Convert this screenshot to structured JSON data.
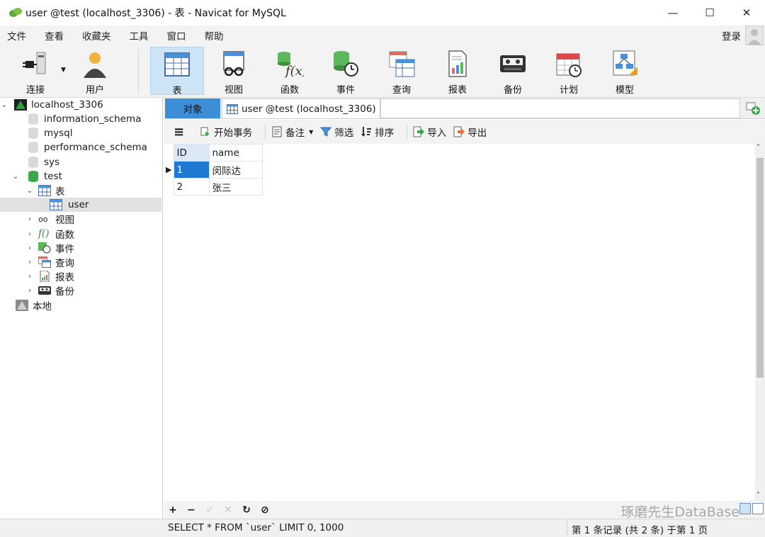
{
  "window": {
    "title": "user @test (localhost_3306) - 表 - Navicat for MySQL",
    "minimize": "—",
    "maximize": "☐",
    "close": "✕"
  },
  "menu": {
    "items": [
      "文件",
      "查看",
      "收藏夹",
      "工具",
      "窗口",
      "帮助"
    ],
    "login": "登录"
  },
  "toolbar": {
    "buttons": [
      {
        "label": "连接",
        "icon": "connection-icon"
      },
      {
        "label": "用户",
        "icon": "user-icon"
      },
      {
        "label": "表",
        "icon": "table-icon",
        "active": true
      },
      {
        "label": "视图",
        "icon": "view-icon"
      },
      {
        "label": "函数",
        "icon": "function-icon"
      },
      {
        "label": "事件",
        "icon": "event-icon"
      },
      {
        "label": "查询",
        "icon": "query-icon"
      },
      {
        "label": "报表",
        "icon": "report-icon"
      },
      {
        "label": "备份",
        "icon": "backup-icon"
      },
      {
        "label": "计划",
        "icon": "schedule-icon"
      },
      {
        "label": "模型",
        "icon": "model-icon"
      }
    ]
  },
  "tree": {
    "connection": "localhost_3306",
    "databases": [
      "information_schema",
      "mysql",
      "performance_schema",
      "sys"
    ],
    "open_db": "test",
    "tables_group": "表",
    "table": "user",
    "groups": [
      "视图",
      "函数",
      "事件",
      "查询",
      "报表",
      "备份"
    ],
    "local": "本地"
  },
  "tabs": {
    "objects": "对象",
    "user_tab": "user @test (localhost_3306) ..."
  },
  "subtoolbar": {
    "begin_tx": "开始事务",
    "comment": "备注",
    "filter": "筛选",
    "sort": "排序",
    "import": "导入",
    "export": "导出"
  },
  "grid": {
    "columns": [
      "ID",
      "name"
    ],
    "rows": [
      [
        "1",
        "闵际达"
      ],
      [
        "2",
        "张三"
      ]
    ]
  },
  "bottombar": {
    "add": "+",
    "remove": "−",
    "apply": "✓",
    "cancel": "✕",
    "refresh": "↻",
    "stop": "⊘",
    "watermark": "琢磨先生DataBase"
  },
  "status": {
    "sql": "SELECT * FROM `user` LIMIT 0, 1000",
    "records": "第 1 条记录 (共 2 条) 于第 1 页"
  }
}
